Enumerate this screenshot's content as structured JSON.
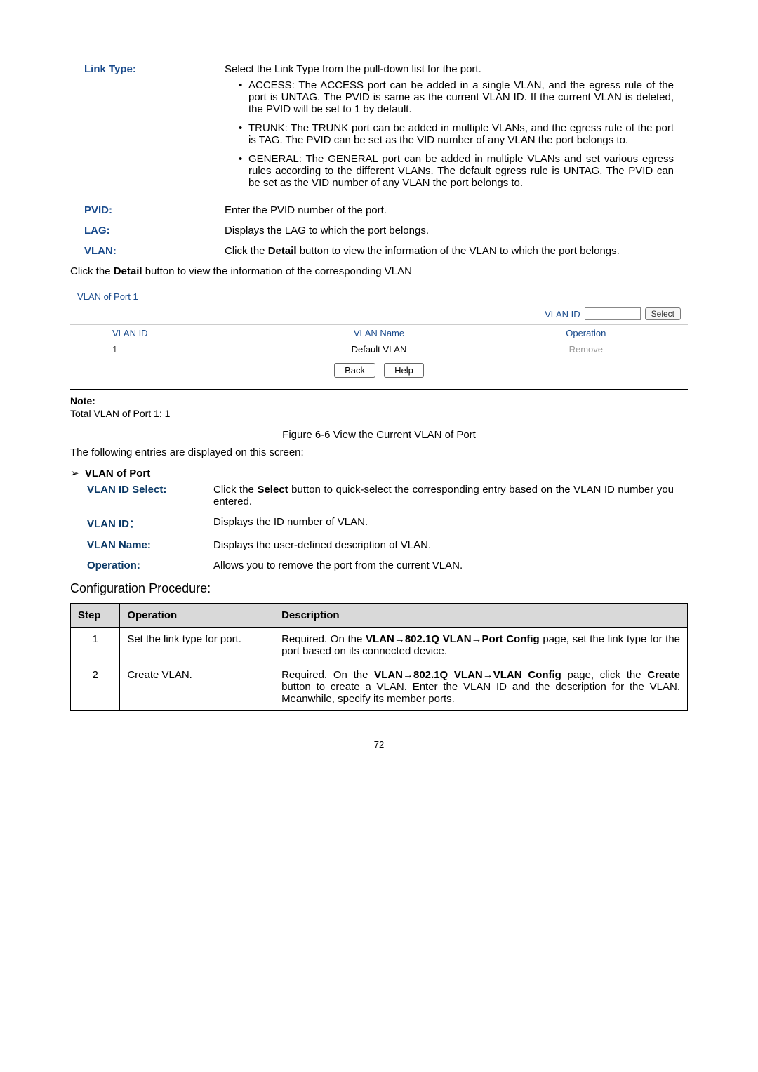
{
  "link_type": {
    "label": "Link Type:",
    "intro": "Select the Link Type from the pull-down list for the port.",
    "bullets": [
      "ACCESS: The ACCESS port can be added in a single VLAN, and the egress rule of the port is UNTAG. The PVID is same as the current VLAN ID. If the current VLAN is deleted, the PVID will be set to 1 by default.",
      "TRUNK: The TRUNK port can be added in multiple VLANs, and the egress rule of the port is TAG. The PVID can be set as the VID number of any VLAN the port belongs to.",
      "GENERAL: The GENERAL port can be added in multiple VLANs and set various egress rules according to the different VLANs. The default egress rule is UNTAG. The PVID can be set as the VID number of any VLAN the port belongs to."
    ]
  },
  "pvid": {
    "label": "PVID:",
    "text": "Enter the PVID number of the port."
  },
  "lag": {
    "label": "LAG:",
    "text": "Displays the LAG to which the port belongs."
  },
  "vlan_def": {
    "label": "VLAN:",
    "textA": "Click the ",
    "bold": "Detail",
    "textB": " button to view the information of the VLAN to which the port belongs."
  },
  "click_detail": {
    "pre": "Click the ",
    "bold": "Detail",
    "post": " button to view the information of the corresponding VLAN"
  },
  "panel": {
    "title": "VLAN of Port 1",
    "vlanid_label": "VLAN ID",
    "select_btn": "Select",
    "headers": {
      "id": "VLAN ID",
      "name": "VLAN Name",
      "op": "Operation"
    },
    "row": {
      "id": "1",
      "name": "Default VLAN",
      "op": "Remove"
    },
    "back": "Back",
    "help": "Help"
  },
  "note": {
    "head": "Note:",
    "body": "Total VLAN of Port 1: 1"
  },
  "fig_caption": "Figure 6-6 View the Current VLAN of Port",
  "entries_line": "The following entries are displayed on this screen:",
  "section_head": "VLAN of Port",
  "vlan_id_select": {
    "label": "VLAN ID Select:",
    "textA": "Click the ",
    "bold": "Select",
    "textB": " button to quick-select the corresponding entry based on the VLAN ID number you entered."
  },
  "vlan_id": {
    "label": "VLAN ID：",
    "text": "Displays the ID number of VLAN."
  },
  "vlan_name": {
    "label": "VLAN Name:",
    "text": "Displays the user-defined description of VLAN."
  },
  "operation": {
    "label": "Operation:",
    "text": "Allows you to remove the port from the current VLAN."
  },
  "config_head": "Configuration Procedure:",
  "table": {
    "head": {
      "step": "Step",
      "op": "Operation",
      "desc": "Description"
    },
    "rows": [
      {
        "step": "1",
        "op": "Set the link type for port.",
        "descA": "Required. On the ",
        "bold1": "VLAN→802.1Q VLAN→Port Config",
        "descB": " page, set the link type for the port based on its connected device."
      },
      {
        "step": "2",
        "op": "Create VLAN.",
        "descA": "Required. On the ",
        "bold1": "VLAN→802.1Q VLAN→VLAN Config",
        "descB": " page, click the ",
        "bold2": "Create",
        "descC": " button to create a VLAN. Enter the VLAN ID and the description for the VLAN. Meanwhile, specify its member ports."
      }
    ]
  },
  "page_number": "72"
}
